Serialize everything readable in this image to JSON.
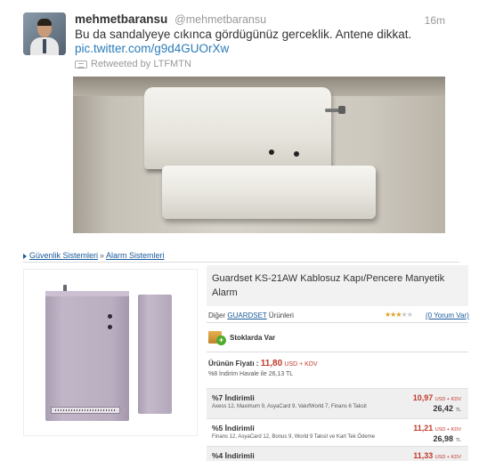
{
  "tweet": {
    "name": "mehmetbaransu",
    "handle": "@mehmetbaransu",
    "time": "16m",
    "text": "Bu da sandalyeye cıkınca gördügünüz gerceklik. Antene dikkat.",
    "link": "pic.twitter.com/g9d4GUOrXw",
    "retweeted_by": "Retweeted by LTFMTN"
  },
  "breadcrumb": {
    "items": [
      "Güvenlik Sistemleri",
      "Alarm Sistemleri"
    ],
    "separator": "»"
  },
  "product": {
    "title": "Guardset KS-21AW Kablosuz Kapı/Pencere Manyetik Alarm",
    "brand_prefix": "Diğer",
    "brand_link": "GUARDSET",
    "brand_suffix": "Ürünleri",
    "rating_stars_on": "★★★",
    "rating_stars_off": "★★",
    "reviews": "(0 Yorum Var)",
    "stock": "Stoklarda Var",
    "price_label": "Ürünün Fiyatı :",
    "price_value": "11,80",
    "price_kdv": "USD + KDV",
    "havale": "%8 İndirim Havale ile 26,13 TL",
    "installments": [
      {
        "title": "%7 İndirimli",
        "banks": "Axess 12, Maximum 9, AsyaCard 9, VakıfWorld 7, Finans 6 Taksit",
        "price": "10,97",
        "price_unit": "USD + KDV",
        "total": "26,42",
        "total_unit": "TL"
      },
      {
        "title": "%5 İndirimli",
        "banks": "Finans 12, AsyaCard 12, Bonus 9, World 9 Taksit ve Kart Tek Ödeme",
        "price": "11,21",
        "price_unit": "USD + KDV",
        "total": "26,98",
        "total_unit": "TL"
      },
      {
        "title": "%4 İndirimli",
        "banks": "",
        "price": "11,33",
        "price_unit": "USD + KDV",
        "total": "",
        "total_unit": ""
      }
    ]
  },
  "colors": {
    "link_blue": "#2b7bb9",
    "breadcrumb_blue": "#1a5a9a",
    "price_red": "#c0392b",
    "title_box": "#f2f2f2",
    "stars": "#e0a020"
  },
  "icons": [
    "avatar",
    "retweet-icon",
    "breadcrumb-arrow-icon",
    "star-icon",
    "stock-box-icon"
  ]
}
